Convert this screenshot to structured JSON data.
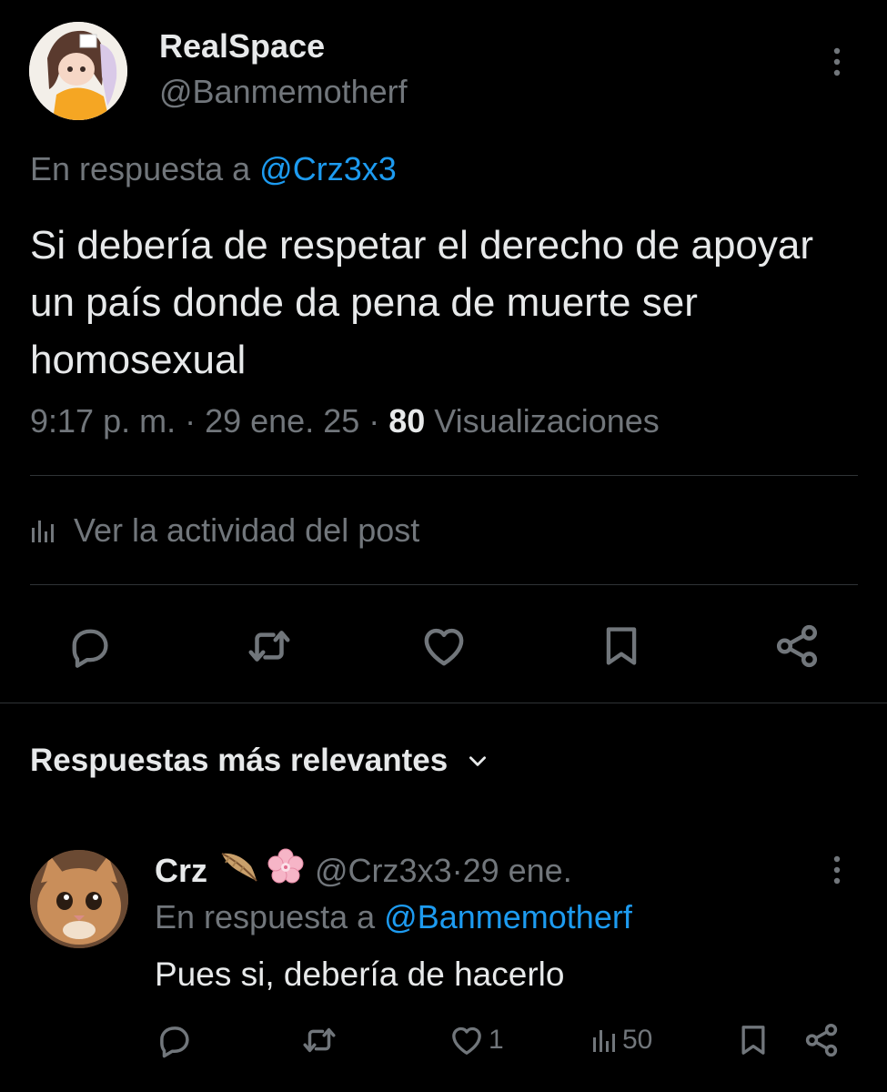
{
  "tweet": {
    "display_name": "RealSpace",
    "handle": "@Banmemotherf",
    "reply_prefix": "En respuesta a",
    "reply_mention": "@Crz3x3",
    "text": "Si debería de respetar el derecho de apoyar un país donde da pena de muerte ser homosexual",
    "time": "9:17 p. m.",
    "sep1": " · ",
    "date": "29 ene. 25",
    "sep2": " · ",
    "views_count": "80",
    "views_label": " Visualizaciones",
    "activity_label": "Ver la actividad del post",
    "actions": {
      "reply_icon": "comment-icon",
      "retweet_icon": "retweet-icon",
      "like_icon": "heart-icon",
      "bookmark_icon": "bookmark-icon",
      "share_icon": "share-icon"
    }
  },
  "replies_section": {
    "sort_label": "Respuestas más relevantes"
  },
  "reply": {
    "display_name": "Crz",
    "emojis": [
      "feather",
      "cherry-blossom"
    ],
    "handle": "@Crz3x3",
    "sep": " · ",
    "date": "29 ene.",
    "reply_prefix": "En respuesta a",
    "reply_mention": "@Banmemotherf",
    "text": "Pues si, debería de hacerlo",
    "likes": "1",
    "views": "50"
  },
  "colors": {
    "background": "#000000",
    "primary_text": "#e7e9ea",
    "secondary_text": "#71767b",
    "accent": "#1d9bf0",
    "divider": "#2f3336"
  }
}
